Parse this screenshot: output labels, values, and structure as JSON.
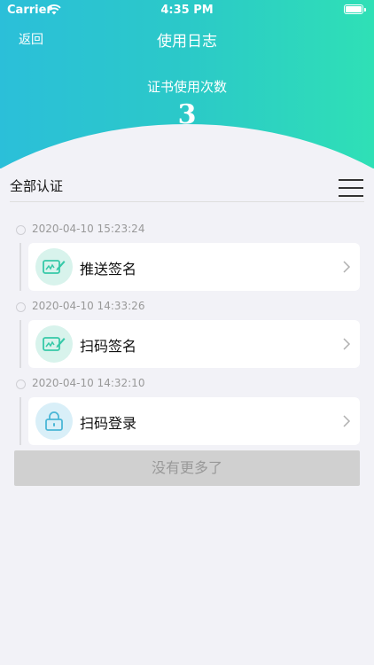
{
  "status_bar": {
    "carrier": "Carrier",
    "time": "4:35 PM"
  },
  "nav": {
    "back_label": "返回",
    "title": "使用日志"
  },
  "summary": {
    "label": "证书使用次数",
    "count": "3"
  },
  "filter": {
    "label": "全部认证"
  },
  "entries": [
    {
      "timestamp": "2020-04-10 15:23:24",
      "label": "推送签名",
      "icon": "signature-icon"
    },
    {
      "timestamp": "2020-04-10 14:33:26",
      "label": "扫码签名",
      "icon": "signature-icon"
    },
    {
      "timestamp": "2020-04-10 14:32:10",
      "label": "扫码登录",
      "icon": "lock-icon"
    }
  ],
  "footer": {
    "no_more_label": "没有更多了"
  },
  "colors": {
    "gradient_start": "#2bbfd9",
    "gradient_end": "#2fe0b6",
    "accent_green": "#36c9a8",
    "accent_blue": "#4ab6d6"
  }
}
